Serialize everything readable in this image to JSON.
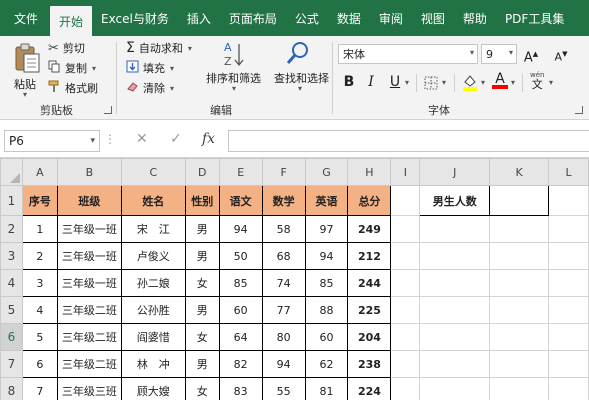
{
  "tabs": [
    "文件",
    "开始",
    "Excel与财务",
    "插入",
    "页面布局",
    "公式",
    "数据",
    "审阅",
    "视图",
    "帮助",
    "PDF工具集"
  ],
  "active_tab": "开始",
  "clipboard": {
    "paste_label": "粘贴",
    "cut_label": "剪切",
    "copy_label": "复制",
    "format_painter_label": "格式刷",
    "group_title": "剪贴板"
  },
  "editing": {
    "autosum_label": "自动求和",
    "fill_label": "填充",
    "clear_label": "清除",
    "sort_filter_label": "排序和筛选",
    "find_select_label": "查找和选择",
    "group_title": "编辑"
  },
  "font": {
    "font_name": "宋体",
    "font_size": "9",
    "bold_label": "B",
    "italic_label": "I",
    "underline_label": "U",
    "font_color_glyph": "A",
    "wen_glyph": "wén",
    "group_title": "字体",
    "fill_color": "#ffff00",
    "font_color": "#ff0000"
  },
  "formula_bar": {
    "name_box": "P6",
    "cancel_glyph": "✕",
    "enter_glyph": "✓",
    "fx_glyph": "fx",
    "formula": ""
  },
  "columns": [
    "A",
    "B",
    "C",
    "D",
    "E",
    "F",
    "G",
    "H",
    "I",
    "J",
    "K",
    "L"
  ],
  "rows": [
    "1",
    "2",
    "3",
    "4",
    "5",
    "6",
    "7",
    "8"
  ],
  "selected_row": "6",
  "table": {
    "headers": [
      "序号",
      "班级",
      "姓名",
      "性别",
      "语文",
      "数学",
      "英语",
      "总分"
    ],
    "data": [
      [
        "1",
        "三年级一班",
        "宋　江",
        "男",
        "94",
        "58",
        "97",
        "249"
      ],
      [
        "2",
        "三年级一班",
        "卢俊义",
        "男",
        "50",
        "68",
        "94",
        "212"
      ],
      [
        "3",
        "三年级一班",
        "孙二娘",
        "女",
        "85",
        "74",
        "85",
        "244"
      ],
      [
        "4",
        "三年级二班",
        "公孙胜",
        "男",
        "60",
        "77",
        "88",
        "225"
      ],
      [
        "5",
        "三年级二班",
        "阎婆惜",
        "女",
        "64",
        "80",
        "60",
        "204"
      ],
      [
        "6",
        "三年级二班",
        "林　冲",
        "男",
        "82",
        "94",
        "62",
        "238"
      ],
      [
        "7",
        "三年级三班",
        "顾大嫂",
        "女",
        "83",
        "55",
        "81",
        "224"
      ]
    ]
  },
  "side": {
    "j1_label": "男生人数",
    "k1_value": ""
  },
  "colors": {
    "ribbon_green": "#217346",
    "header_fill": "#f4b183"
  }
}
